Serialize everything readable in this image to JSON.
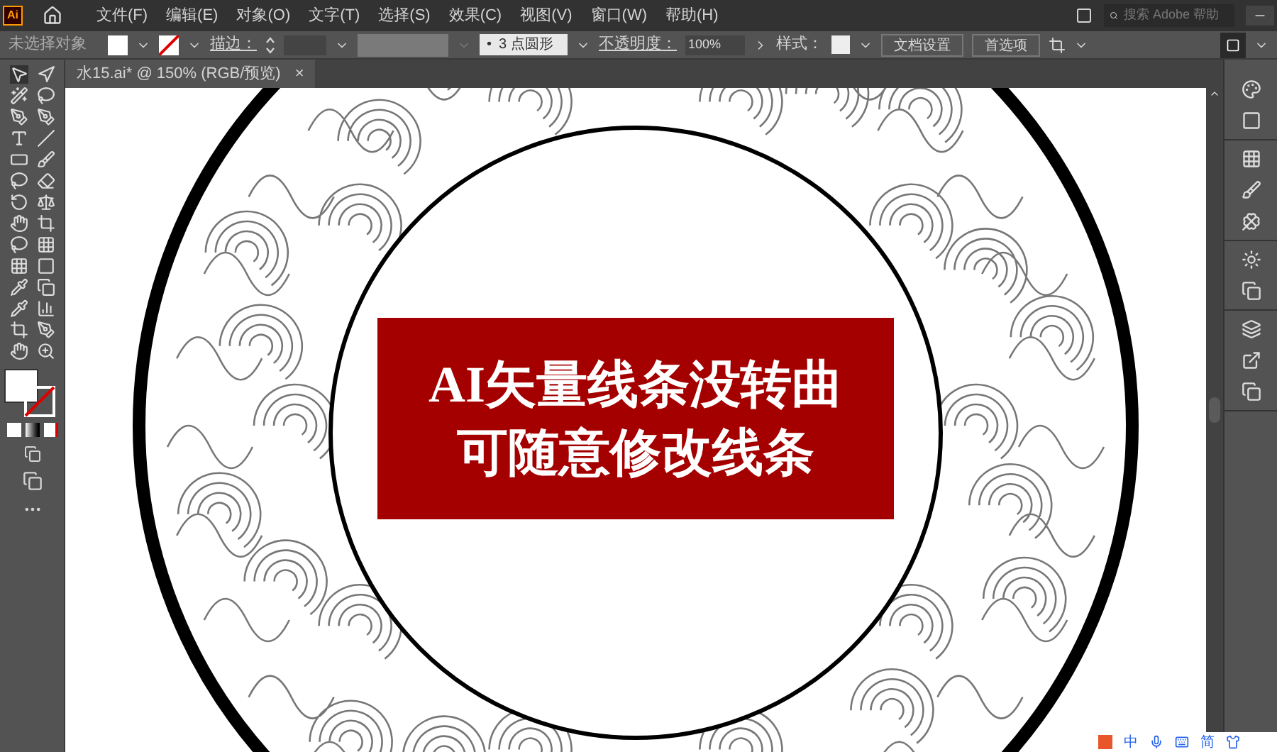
{
  "app_logo": "Ai",
  "menu": [
    {
      "label": "文件(F)"
    },
    {
      "label": "编辑(E)"
    },
    {
      "label": "对象(O)"
    },
    {
      "label": "文字(T)"
    },
    {
      "label": "选择(S)"
    },
    {
      "label": "效果(C)"
    },
    {
      "label": "视图(V)"
    },
    {
      "label": "窗口(W)"
    },
    {
      "label": "帮助(H)"
    }
  ],
  "search": {
    "placeholder": "搜索 Adobe 帮助"
  },
  "control_bar": {
    "selection": "未选择对象",
    "stroke_label": "描边：",
    "brush": "3 点圆形",
    "brush_bullet": "•",
    "opacity_label": "不透明度：",
    "opacity": "100%",
    "style_label": "样式：",
    "buttons": [
      "文档设置",
      "首选项"
    ]
  },
  "document_tab": {
    "title": "水15.ai* @ 150% (RGB/预览)",
    "close": "×"
  },
  "banner": {
    "lines": [
      "AI矢量线条没转曲",
      "可随意修改线条"
    ]
  },
  "ime_bar": {
    "items": [
      {
        "kind": "text",
        "label": "中"
      },
      {
        "kind": "icon"
      },
      {
        "kind": "icon"
      },
      {
        "kind": "text",
        "label": "简"
      }
    ]
  }
}
